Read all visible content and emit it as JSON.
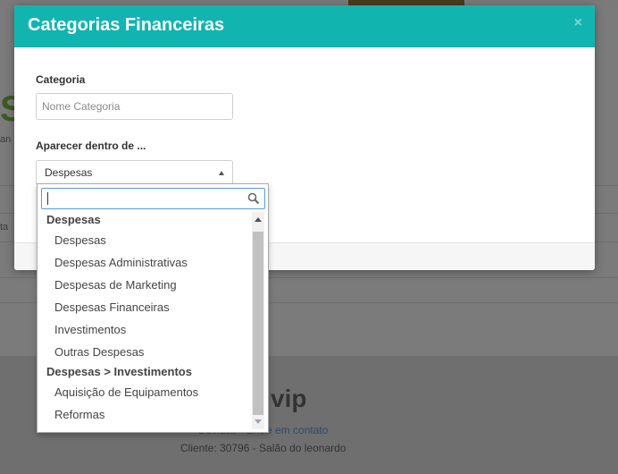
{
  "modal": {
    "title": "Categorias Financeiras",
    "close": "×",
    "category_label": "Categoria",
    "category_placeholder": "Nome Categoria",
    "parent_label": "Aparecer dentro de ...",
    "parent_selected": "Despesas"
  },
  "dropdown": {
    "search_value": "",
    "groups": [
      {
        "label": "Despesas",
        "options": [
          "Despesas",
          "Despesas Administrativas",
          "Despesas de Marketing",
          "Despesas Financeiras",
          "Investimentos",
          "Outras Despesas"
        ]
      },
      {
        "label": "Despesas > Investimentos",
        "options": [
          "Aquisição de Equipamentos",
          "Reformas"
        ]
      }
    ]
  },
  "background": {
    "dollar_fragment": "S",
    "side_fragment_1": "an",
    "side_fragment_2": "ta",
    "brand_fragment": "vip",
    "footer_links": "Dúvidas · Entre em contato",
    "client_line": "Cliente: 30796 - Salão do leonardo"
  },
  "colors": {
    "header": "#12b4af",
    "focus_border": "#5b9bd5",
    "overlay": "#7b7b7b"
  },
  "icons": [
    "close-icon",
    "select-arrow-icon",
    "search-icon",
    "scroll-up-icon",
    "scroll-down-icon"
  ]
}
